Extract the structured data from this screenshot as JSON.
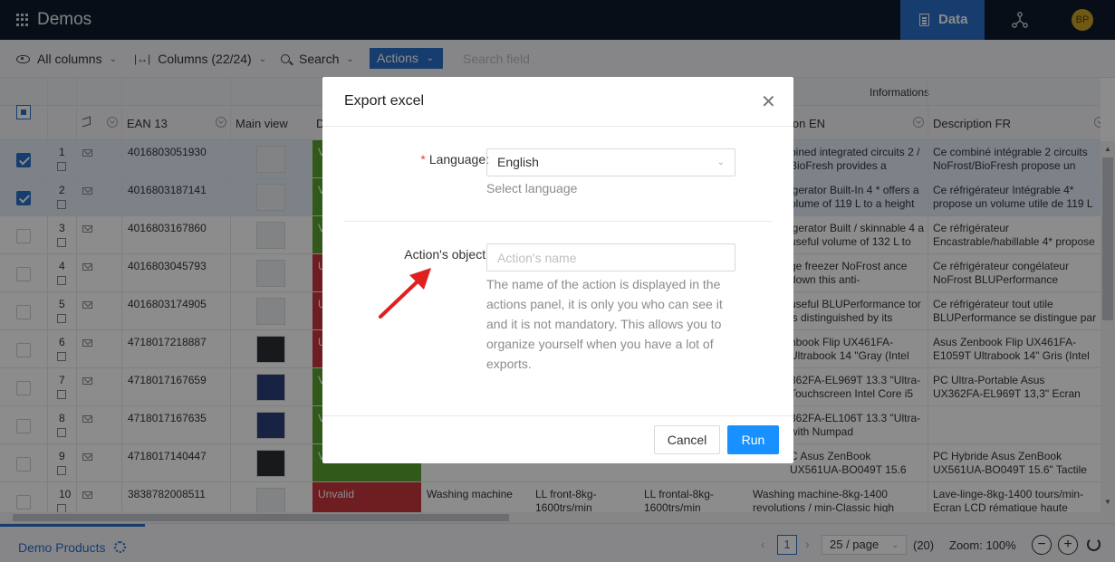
{
  "topbar": {
    "app_title": "Demos",
    "nav_data_label": "Data",
    "avatar_initials": "BP"
  },
  "toolbar": {
    "all_columns": "All columns",
    "columns": "Columns (22/24)",
    "search": "Search",
    "actions": "Actions",
    "search_field": "Search field"
  },
  "grid": {
    "group_header": "Informations",
    "headers": {
      "ean": "EAN 13",
      "main_view": "Main view",
      "d": "D",
      "desc_en": "ion EN",
      "desc_fr": "Description FR"
    },
    "rows": [
      {
        "num": "1",
        "ean": "4016803051930",
        "status": "V",
        "desc_en": "bined integrated circuits 2 / BioFresh provides a",
        "desc_fr": "Ce combiné intégrable 2 circuits NoFrost/BioFresh propose un"
      },
      {
        "num": "2",
        "ean": "4016803187141",
        "status": "V",
        "desc_en": "igerator Built-In 4 * offers a olume of 119 L to a height",
        "desc_fr": "Ce réfrigérateur Intégrable 4* propose un volume utile de 119 L"
      },
      {
        "num": "3",
        "ean": "4016803167860",
        "status": "V",
        "desc_en": "igerator Built / skinnable 4 a useful volume of 132 L to",
        "desc_fr": "Ce réfrigérateur Encastrable/habillable 4* propose"
      },
      {
        "num": "4",
        "ean": "4016803045793",
        "status": "U",
        "desc_en": "ge freezer NoFrost ance down this anti-",
        "desc_fr": "Ce réfrigérateur congélateur NoFrost BLUPerformance descend"
      },
      {
        "num": "5",
        "ean": "4016803174905",
        "status": "U",
        "desc_en": "useful BLUPerformance tor is distinguished by its",
        "desc_fr": "Ce réfrigérateur tout utile BLUPerformance se distingue par"
      },
      {
        "num": "6",
        "ean": "4718017218887",
        "status": "U",
        "desc_en": "nbook Flip UX461FA- Ultrabook 14 \"Gray (Intel",
        "desc_fr": "Asus Zenbook Flip UX461FA-E1059T Ultrabook 14\" Gris (Intel"
      },
      {
        "num": "7",
        "ean": "4718017167659",
        "status": "V",
        "desc_en": "362FA-EL969T 13.3 \"Ultra- Touchscreen Intel Core i5",
        "desc_fr": "PC Ultra-Portable Asus UX362FA-EL969T 13,3\" Ecran tactile Intel"
      },
      {
        "num": "8",
        "ean": "4718017167635",
        "status": "V",
        "desc_en": "362FA-EL106T 13.3 \"Ultra- with Numpad",
        "desc_fr": ""
      },
      {
        "num": "9",
        "ean": "4718017140447",
        "status": "V",
        "desc_en": "C Asus ZenBook UX561UA-BO049T 15.6 \"Touch",
        "desc_fr": "PC Hybride Asus ZenBook UX561UA-BO049T 15.6\" Tactile"
      },
      {
        "num": "10",
        "ean": "3838782008511",
        "status": "Unvalid",
        "c1": "Washing machine",
        "c2": "LL front-8kg-1600trs/min",
        "c3": "LL frontal-8kg-1600trs/min",
        "desc_en": "Washing machine-8kg-1400 revolutions / min-Classic high",
        "desc_fr": "Lave-linge-8kg-1400 tours/min-Ecran LCD rématique haute"
      }
    ]
  },
  "footer": {
    "tab_label": "Demo Products",
    "page_current": "1",
    "page_size": "25 / page",
    "count": "(20)",
    "zoom": "Zoom: 100%"
  },
  "modal": {
    "title": "Export excel",
    "language_label": "Language",
    "language_value": "English",
    "language_help": "Select language",
    "object_label": "Action's object",
    "object_placeholder": "Action's name",
    "object_help": "The name of the action is displayed in the actions panel, it is only you who can see it and it is not mandatory. This allows you to organize yourself when you have a lot of exports.",
    "cancel": "Cancel",
    "run": "Run"
  },
  "colors": {
    "topbar": "#0e1a2b",
    "accent": "#2a6fc9",
    "valid": "#5aa32e",
    "unvalid": "#c9353b",
    "primary_button": "#1890ff",
    "annotation_arrow": "#e02020"
  },
  "icons": [
    "apps-grid-icon",
    "document-icon",
    "graph-icon",
    "eye-icon",
    "columns-icon",
    "search-icon",
    "bell-icon",
    "mail-icon",
    "edit-icon",
    "gear-icon",
    "refresh-icon",
    "close-icon",
    "chevron-down-icon"
  ]
}
